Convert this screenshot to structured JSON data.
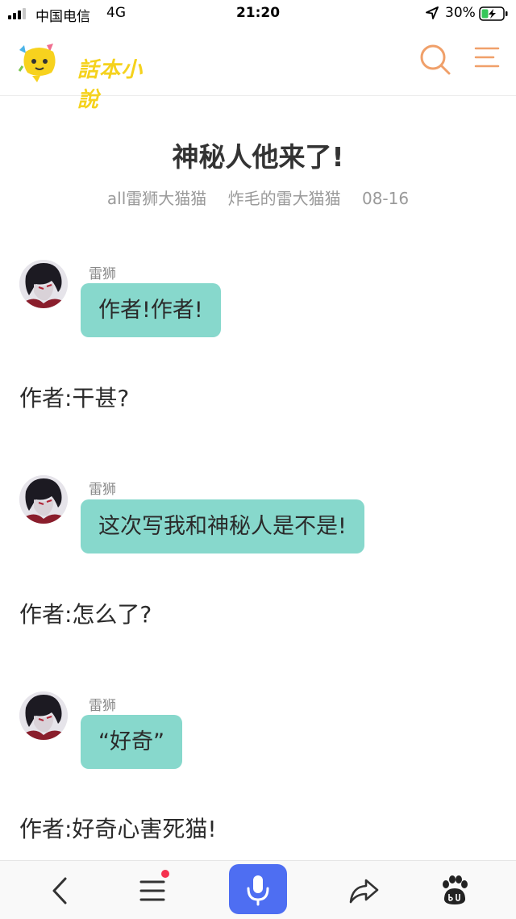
{
  "status_bar": {
    "carrier": "中国电信",
    "network": "4G",
    "time": "21:20",
    "battery": "30%"
  },
  "header": {
    "logo_text": "話本小說",
    "logo_color": "#f5d21d",
    "accent_color": "#f0a06a"
  },
  "article": {
    "title": "神秘人他来了!",
    "meta": {
      "tags": "all雷狮大猫猫",
      "author": "炸毛的雷大猫猫",
      "date": "08-16"
    }
  },
  "chat": [
    {
      "speaker": "雷狮",
      "text": "作者!作者!"
    },
    {
      "narration": "作者:干甚?"
    },
    {
      "speaker": "雷狮",
      "text": "这次写我和神秘人是不是!"
    },
    {
      "narration": "作者:怎么了?"
    },
    {
      "speaker": "雷狮",
      "text": "“好奇”"
    },
    {
      "narration": "作者:好奇心害死猫!"
    }
  ],
  "bubble_color": "#87d8cc",
  "bottom_bar": {
    "icons": [
      "back-icon",
      "list-menu-icon",
      "microphone-icon",
      "share-icon",
      "baidu-paw-icon"
    ],
    "voice_button_color": "#4e6ef2",
    "notification_dot_color": "#f5314f"
  }
}
